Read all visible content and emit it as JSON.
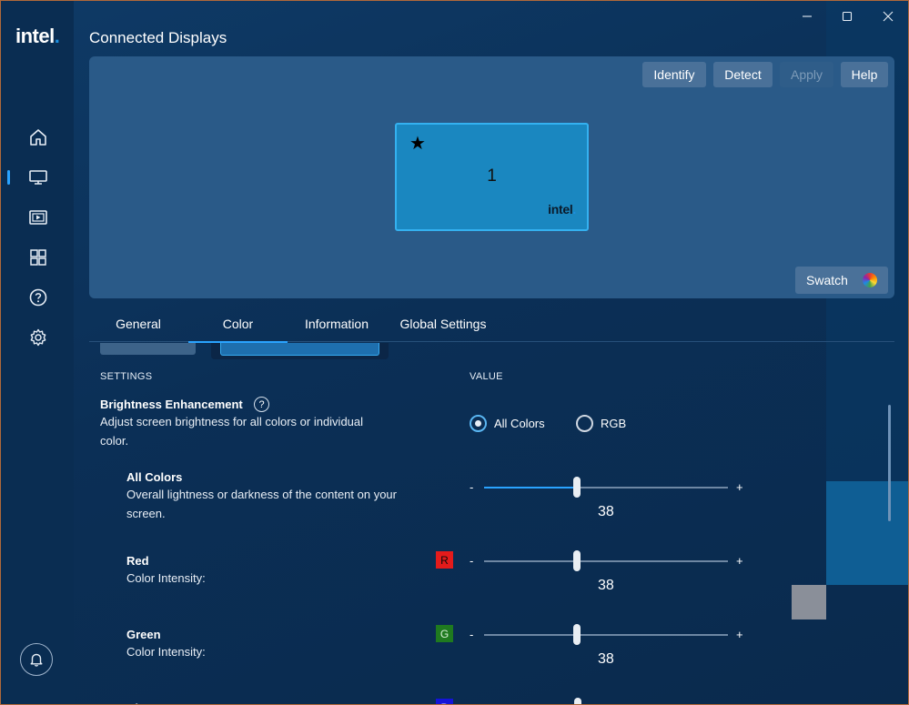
{
  "app": {
    "logo": "intel",
    "logo_dot": "."
  },
  "window_controls": {
    "minimize": "—",
    "maximize": "☐",
    "close": "✕"
  },
  "sidebar": {
    "items": [
      {
        "name": "home",
        "icon": "home-icon"
      },
      {
        "name": "display",
        "icon": "monitor-icon",
        "active": true
      },
      {
        "name": "video",
        "icon": "video-icon"
      },
      {
        "name": "apps",
        "icon": "grid-icon"
      },
      {
        "name": "help",
        "icon": "help-icon"
      },
      {
        "name": "settings",
        "icon": "gear-icon"
      }
    ],
    "notifications_icon": "bell-icon"
  },
  "page": {
    "title": "Connected Displays"
  },
  "display_area": {
    "buttons": {
      "identify": "Identify",
      "detect": "Detect",
      "apply": "Apply",
      "help": "Help"
    },
    "monitor": {
      "star": "★",
      "number": "1",
      "logo": "intel",
      "logo_dot": "."
    },
    "swatch": {
      "label": "Swatch"
    }
  },
  "tabs": [
    {
      "label": "General"
    },
    {
      "label": "Color",
      "active": true
    },
    {
      "label": "Information"
    },
    {
      "label": "Global Settings"
    }
  ],
  "columns": {
    "settings": "SETTINGS",
    "value": "VALUE"
  },
  "brightness": {
    "title": "Brightness Enhancement",
    "help": "?",
    "desc_line1": "Adjust screen brightness for all colors or individual",
    "desc_line2": "color.",
    "options": {
      "all": "All Colors",
      "rgb": "RGB"
    },
    "selected": "All Colors"
  },
  "sliders": {
    "minus": "-",
    "plus": "+",
    "all_colors": {
      "title": "All Colors",
      "desc_line1": "Overall lightness or darkness of the content on your",
      "desc_line2": "screen.",
      "value": "38",
      "level": 0.38
    },
    "red": {
      "title": "Red",
      "desc": "Color Intensity:",
      "badge": "R",
      "badge_color": "#e31b1b",
      "value": "38",
      "level": 0.38
    },
    "green": {
      "title": "Green",
      "desc": "Color Intensity:",
      "badge": "G",
      "badge_color": "#1f7a1f",
      "value": "38",
      "level": 0.38
    },
    "blue": {
      "title": "Bl",
      "badge": "B",
      "badge_color": "#1414d8"
    }
  },
  "colors": {
    "accent": "#2aa3ff",
    "window_bg": "#0b2f56",
    "sidebar_bg": "#0a2d52"
  }
}
